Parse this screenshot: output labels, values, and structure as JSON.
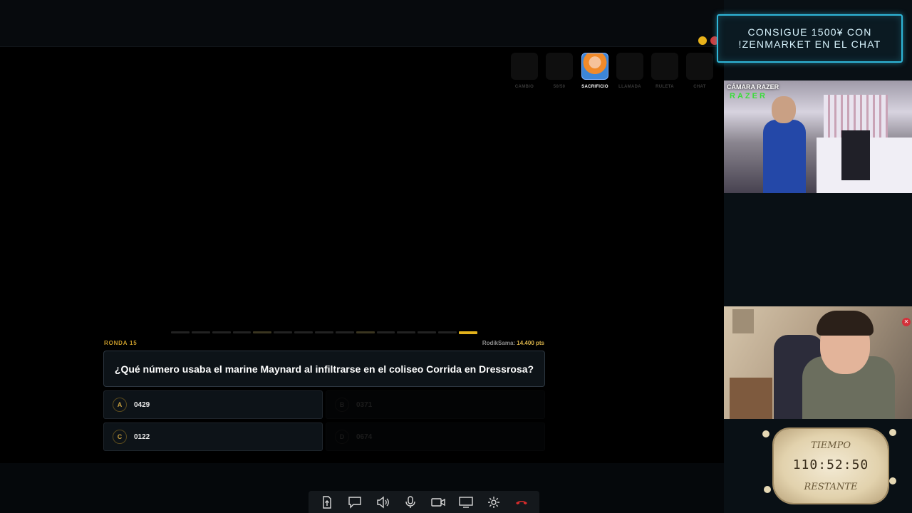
{
  "window_controls": {
    "minimize_color": "#e8b21a",
    "close_color": "#d23a3a"
  },
  "power_cards": [
    {
      "label": "CAMBIO",
      "icon": "card-cambio-icon",
      "active": false
    },
    {
      "label": "50/50",
      "icon": "card-5050-icon",
      "active": false
    },
    {
      "label": "SACRIFICIO",
      "icon": "card-sacrificio-icon",
      "active": true
    },
    {
      "label": "LLAMADA",
      "icon": "card-llamada-icon",
      "active": false
    },
    {
      "label": "RULETA",
      "icon": "card-ruleta-icon",
      "active": false
    },
    {
      "label": "CHAT",
      "icon": "card-chat-icon",
      "active": false
    }
  ],
  "round": {
    "label": "RONDA 15",
    "total_segments": 15,
    "current_segment": 15,
    "score_player": "RodikSama:",
    "score_points": "14.400 pts"
  },
  "question": {
    "text": "¿Qué número usaba el marine Maynard al infiltrarse en el coliseo Corrida en Dressrosa?"
  },
  "answers": [
    {
      "letter": "A",
      "text": "0429",
      "eliminated": false
    },
    {
      "letter": "B",
      "text": "0371",
      "eliminated": true
    },
    {
      "letter": "C",
      "text": "0122",
      "eliminated": false
    },
    {
      "letter": "D",
      "text": "0674",
      "eliminated": true
    }
  ],
  "toolbar": [
    {
      "name": "share-file-button",
      "icon": "upload-file-icon"
    },
    {
      "name": "chat-button",
      "icon": "chat-icon"
    },
    {
      "name": "speaker-button",
      "icon": "speaker-icon"
    },
    {
      "name": "microphone-button",
      "icon": "microphone-icon"
    },
    {
      "name": "camera-button",
      "icon": "camera-icon"
    },
    {
      "name": "screen-share-button",
      "icon": "monitor-icon"
    },
    {
      "name": "settings-button",
      "icon": "gear-icon"
    },
    {
      "name": "hang-up-button",
      "icon": "phone-hangup-icon"
    }
  ],
  "promo": {
    "line1": "CONSIGUE 1500¥ CON",
    "line2": "!ZENMARKET EN EL CHAT",
    "border_color": "#2fb6d8"
  },
  "webcam_top": {
    "title": "CÁMARA RAZER",
    "brand": "RAZER"
  },
  "timer": {
    "top_label": "TIEMPO",
    "value": "110:52:50",
    "bottom_label": "RESTANTE"
  },
  "colors": {
    "accent_gold": "#e3b21c",
    "panel_bg": "#0d1318",
    "hangup_red": "#d42b2b"
  }
}
